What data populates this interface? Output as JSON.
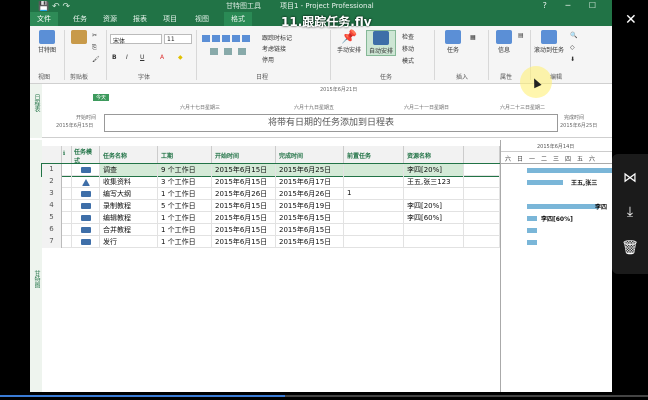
{
  "video": {
    "title": "11.跟踪任务.flv",
    "progress": 0.44
  },
  "window": {
    "title": "项目1 - Project Professional",
    "tools_label": "甘特图工具",
    "file_tab": "文件"
  },
  "tabs": [
    "任务",
    "资源",
    "报表",
    "项目",
    "视图",
    "格式"
  ],
  "ribbon": {
    "view": {
      "button": "甘特图",
      "group": "视图"
    },
    "clipboard": {
      "group": "剪贴板"
    },
    "font": {
      "face": "宋体",
      "size": "11",
      "group": "字体",
      "bold": "B",
      "italic": "I",
      "underline": "U"
    },
    "schedule": {
      "track": "跟踪时标记",
      "respect": "考虑链接",
      "inactive": "停用",
      "group": "日程"
    },
    "tasks": {
      "manual": "手动安排",
      "auto": "自动安排",
      "inspect": "检查",
      "move": "移动",
      "mode": "模式",
      "group": "任务"
    },
    "insert": {
      "task": "任务",
      "group": "插入"
    },
    "properties": {
      "info": "信息",
      "group": "属性"
    },
    "editing": {
      "scroll": "滚动到任务",
      "group": "编辑"
    }
  },
  "timeline": {
    "side_label": "日程表",
    "today": "今天",
    "start_label": "开始时间",
    "start_date": "2015年6月15日",
    "finish_label": "完成时间",
    "finish_date": "2015年6月25日",
    "header_date": "2015年6月21日",
    "ticks": [
      "六月十七日星期三",
      "六月十九日星期五",
      "六月二十一日星期日",
      "六月二十三日星期二"
    ],
    "placeholder": "将带有日期的任务添加到日程表"
  },
  "gantt_side_label": "甘特图",
  "grid": {
    "headers": {
      "info": "ℹ",
      "mode": "任务模式",
      "name": "任务名称",
      "duration": "工期",
      "start": "开始时间",
      "finish": "完成时间",
      "predecessors": "前置任务",
      "resources": "资源名称"
    },
    "rows": [
      {
        "id": "1",
        "mode": "auto",
        "name": "调查",
        "duration": "9 个工作日",
        "start": "2015年6月15日",
        "finish": "2015年6月25日",
        "pred": "",
        "res": "李四[20%]"
      },
      {
        "id": "2",
        "mode": "manual",
        "name": "收集资料",
        "duration": "3 个工作日",
        "start": "2015年6月15日",
        "finish": "2015年6月17日",
        "pred": "",
        "res": "王五,张三123"
      },
      {
        "id": "3",
        "mode": "auto",
        "name": "编写大纲",
        "duration": "1 个工作日",
        "start": "2015年6月26日",
        "finish": "2015年6月26日",
        "pred": "1",
        "res": ""
      },
      {
        "id": "4",
        "mode": "auto",
        "name": "录制教程",
        "duration": "5 个工作日",
        "start": "2015年6月15日",
        "finish": "2015年6月19日",
        "pred": "",
        "res": "李四[20%]"
      },
      {
        "id": "5",
        "mode": "auto",
        "name": "编辑教程",
        "duration": "1 个工作日",
        "start": "2015年6月15日",
        "finish": "2015年6月15日",
        "pred": "",
        "res": "李四[60%]"
      },
      {
        "id": "6",
        "mode": "auto",
        "name": "合并教程",
        "duration": "1 个工作日",
        "start": "2015年6月15日",
        "finish": "2015年6月15日",
        "pred": "",
        "res": ""
      },
      {
        "id": "7",
        "mode": "auto",
        "name": "发行",
        "duration": "1 个工作日",
        "start": "2015年6月15日",
        "finish": "2015年6月15日",
        "pred": "",
        "res": ""
      }
    ]
  },
  "chart": {
    "week_header": "2015年6月14日",
    "days": [
      "六",
      "日",
      "一",
      "二",
      "三",
      "四",
      "五",
      "六"
    ],
    "bar_labels": [
      "王五,张三",
      "李四",
      "李四[60%]"
    ]
  },
  "colors": {
    "project_green": "#217346",
    "bar_blue": "#7ab6d8",
    "progress_blue": "#3a7bd5"
  }
}
